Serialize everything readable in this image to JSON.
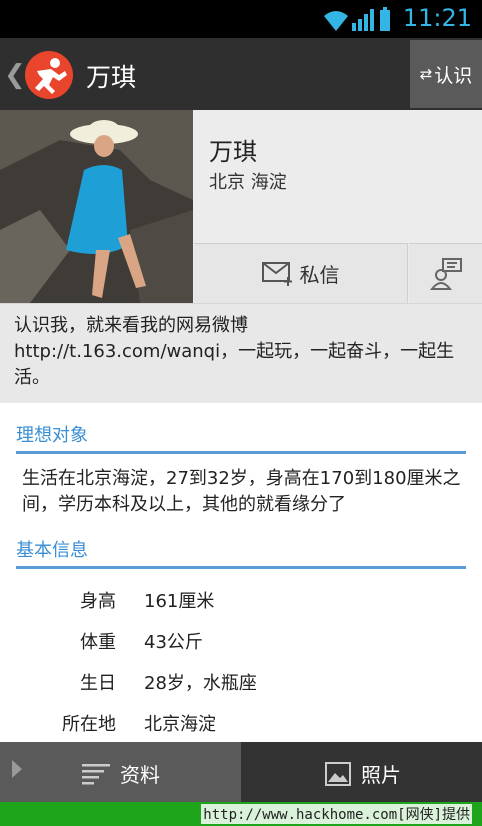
{
  "status": {
    "time": "11:21"
  },
  "header": {
    "title": "万琪",
    "know_label": "认识"
  },
  "profile": {
    "name": "万琪",
    "location": "北京 海淀",
    "message_label": "私信"
  },
  "intro": "认识我，就来看我的网易微博http://t.163.com/wanqi，一起玩，一起奋斗，一起生活。",
  "ideal": {
    "title": "理想对象",
    "text": "生活在北京海淀，27到32岁，身高在170到180厘米之间，学历本科及以上，其他的就看缘分了"
  },
  "basic": {
    "title": "基本信息",
    "rows": [
      {
        "k": "身高",
        "v": "161厘米"
      },
      {
        "k": "体重",
        "v": "43公斤"
      },
      {
        "k": "生日",
        "v": "28岁，水瓶座"
      },
      {
        "k": "所在地",
        "v": "北京海淀"
      }
    ]
  },
  "tabs": {
    "profile_label": "资料",
    "photos_label": "照片"
  },
  "footer": {
    "text": "http://www.hackhome.com[网侠]提供"
  },
  "colors": {
    "accent": "#3a8fd4",
    "logo": "#e8452c",
    "footer": "#1ea51c"
  }
}
